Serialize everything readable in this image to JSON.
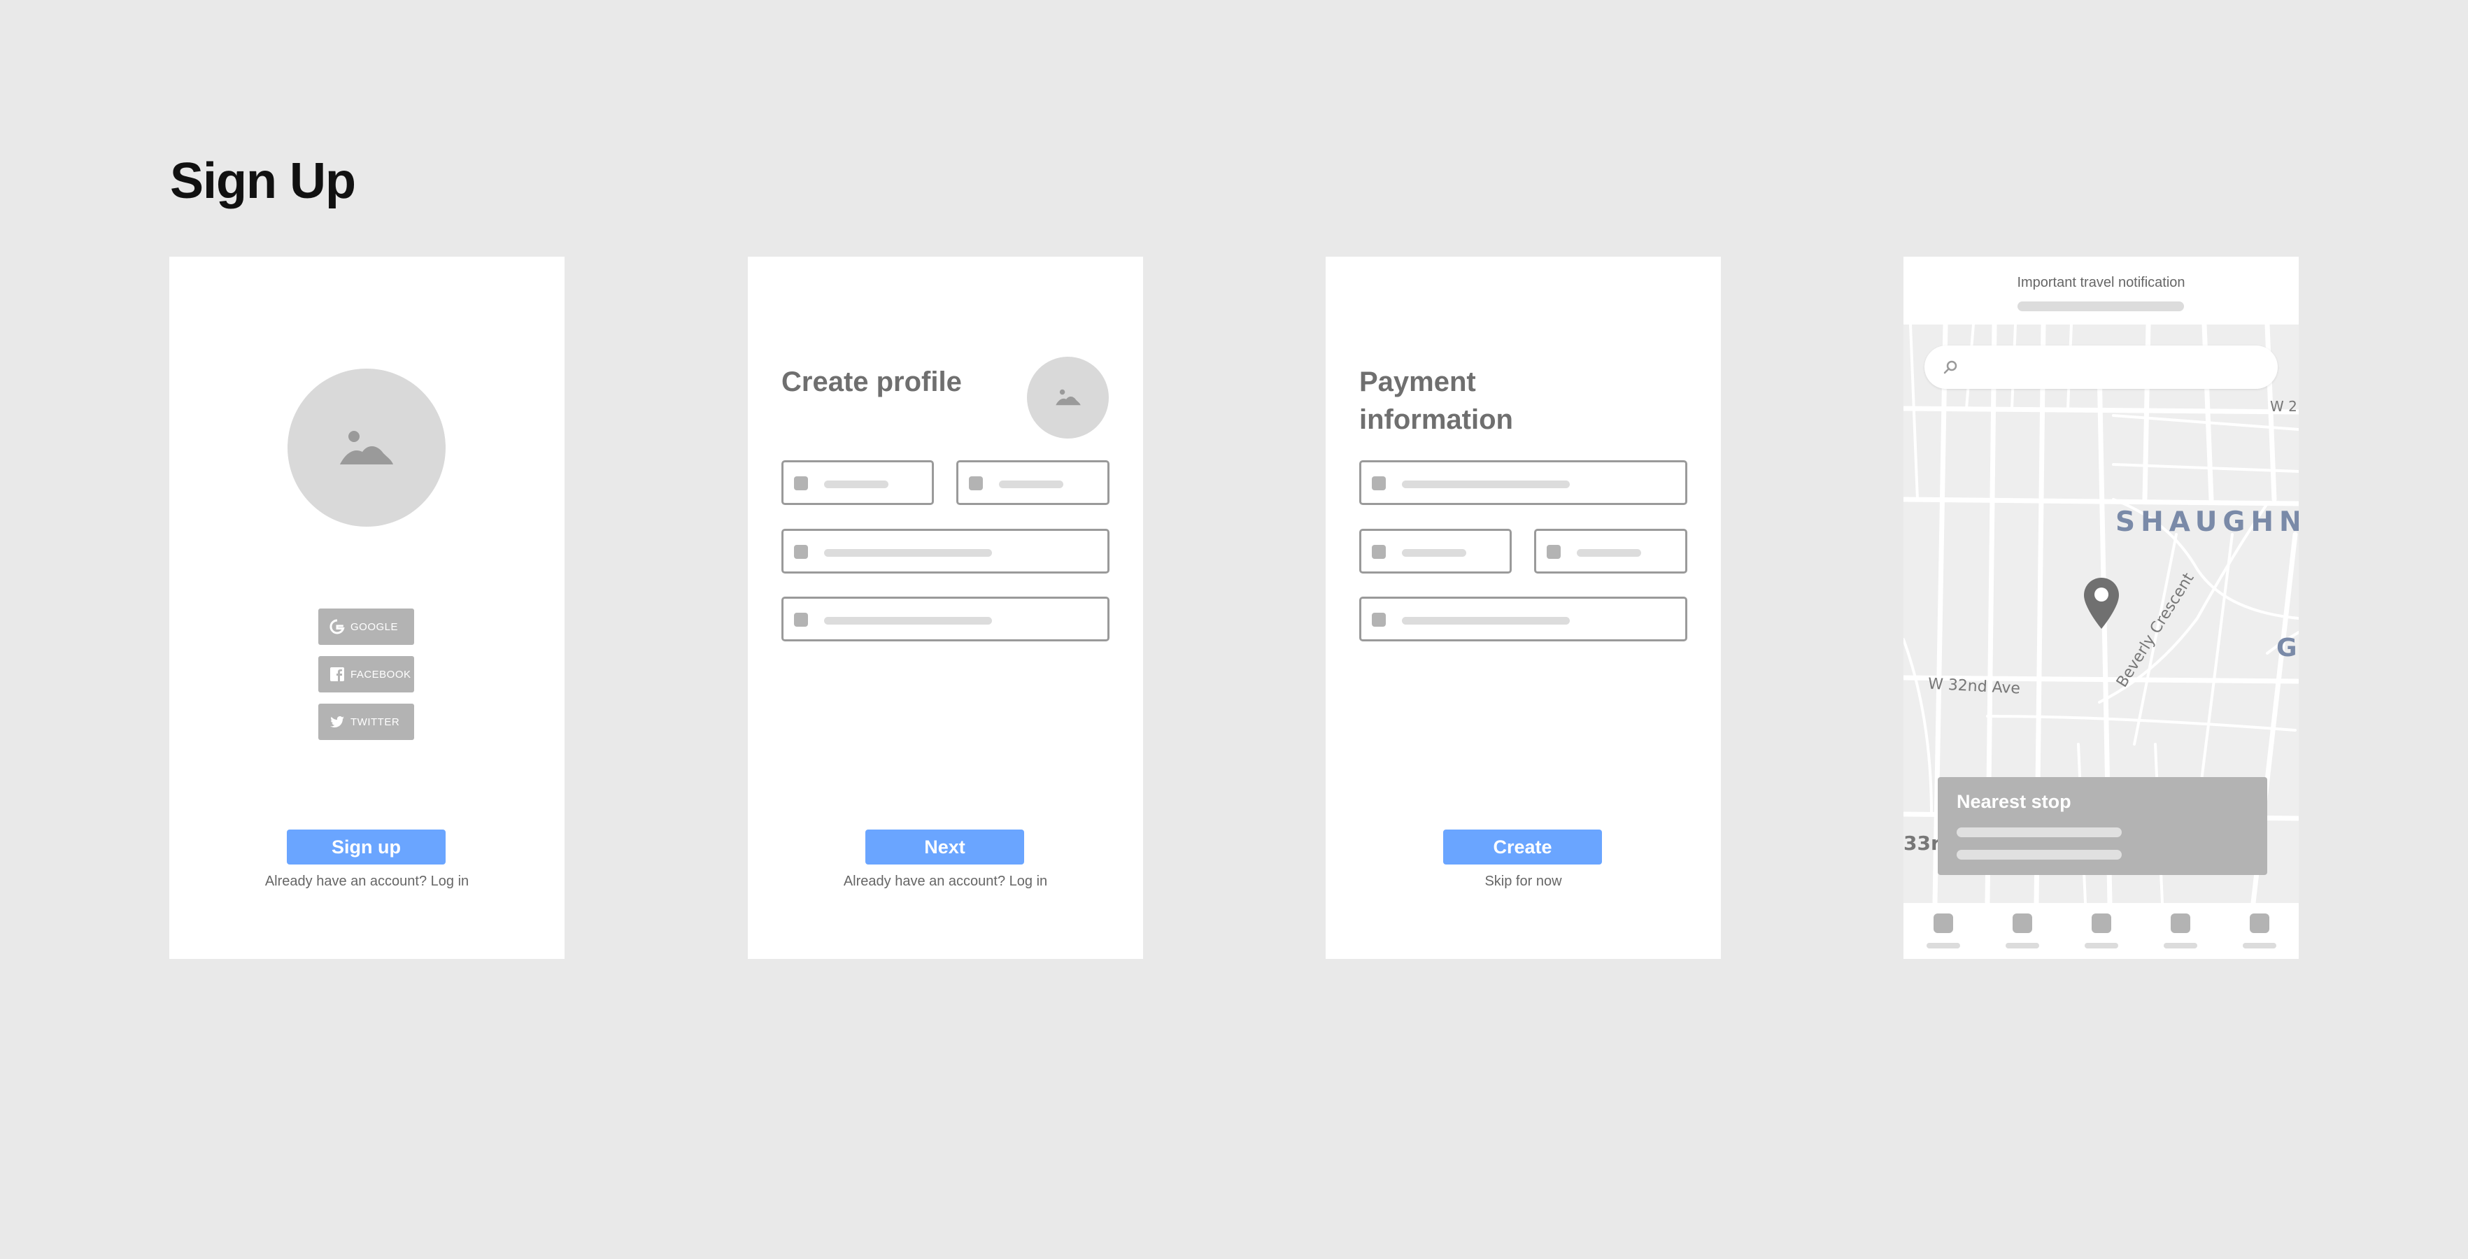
{
  "page": {
    "title": "Sign Up"
  },
  "screen1": {
    "social": [
      {
        "label": "GOOGLE",
        "icon": "google-icon"
      },
      {
        "label": "FACEBOOK",
        "icon": "facebook-icon"
      },
      {
        "label": "TWITTER",
        "icon": "twitter-icon"
      }
    ],
    "primary_button": "Sign up",
    "link_text": "Already have an account? Log in"
  },
  "screen2": {
    "title": "Create profile",
    "primary_button": "Next",
    "link_text": "Already have an account? Log in"
  },
  "screen3": {
    "title": "Payment information",
    "primary_button": "Create",
    "link_text": "Skip for now"
  },
  "screen4": {
    "notification": "Important travel notification",
    "map": {
      "neighborhood": "SHAUGHN",
      "streets": [
        "Beverly Crescent",
        "W 32nd Ave",
        "W 2",
        "33r",
        "G"
      ]
    },
    "card_title": "Nearest stop",
    "tabs": 5
  },
  "colors": {
    "primary": "#6aa5ff",
    "placeholder": "#b3b3b3",
    "background": "#e9e9e9"
  }
}
